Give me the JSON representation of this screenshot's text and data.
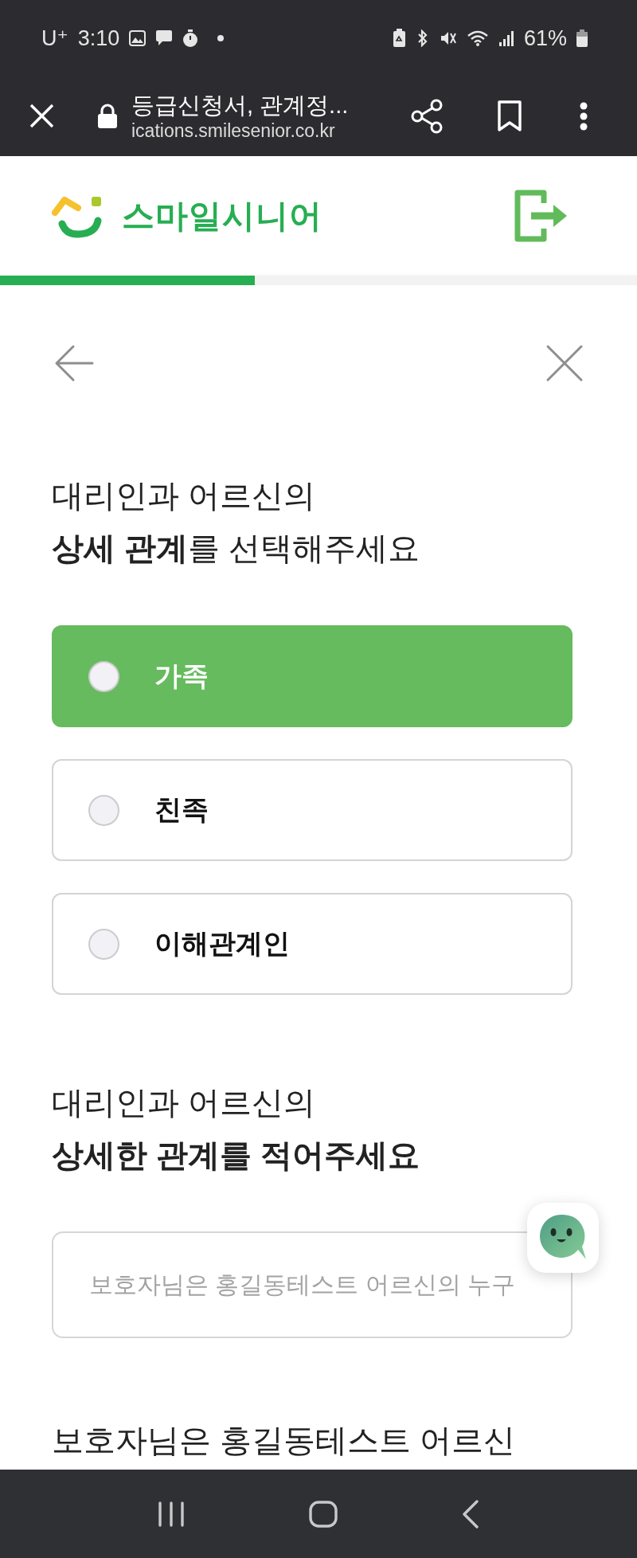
{
  "status_bar": {
    "carrier": "U⁺",
    "time": "3:10",
    "battery": "61%"
  },
  "browser_bar": {
    "title": "등급신청서, 관계정...",
    "url": "ications.smilesenior.co.kr"
  },
  "header": {
    "logo_text": "스마일시니어"
  },
  "progress": {
    "level": 0.4
  },
  "question_1": {
    "title": "대리인과 어르신의\n**상세 관계**를 선택해주세요"
  },
  "options": [
    {
      "label": "가족",
      "selected": true
    },
    {
      "label": "친족",
      "selected": false
    },
    {
      "label": "이해관계인",
      "selected": false
    }
  ],
  "question_2": {
    "title": "대리인과 어르신의\n**상세한 관계를 적어주세요**"
  },
  "relation_input": {
    "placeholder": "보호자님은 홍길동테스트 어르신의 누구"
  },
  "question_3": {
    "title": "보호자님은 홍길동테스트 어르신"
  }
}
